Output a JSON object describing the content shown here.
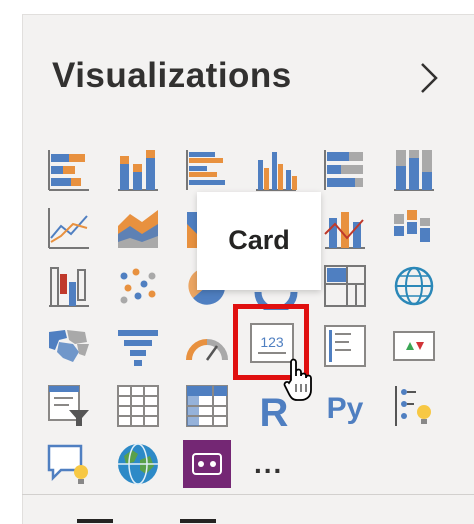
{
  "panel": {
    "title": "Visualizations"
  },
  "tooltip": {
    "text": "Card"
  },
  "more": {
    "label": "..."
  },
  "icons": {
    "collapse": "chevron-right-icon",
    "stacked_bar": "stacked-bar-chart-icon",
    "stacked_column": "stacked-column-chart-icon",
    "clustered_bar": "clustered-bar-chart-icon",
    "clustered_column": "clustered-column-chart-icon",
    "bar_100": "100-stacked-bar-chart-icon",
    "column_100": "100-stacked-column-chart-icon",
    "line": "line-chart-icon",
    "area": "area-chart-icon",
    "line_column": "line-and-column-chart-icon",
    "ribbon": "ribbon-chart-icon",
    "waterfall": "waterfall-chart-icon",
    "scatter": "scatter-chart-icon",
    "pie": "pie-chart-icon",
    "treemap": "treemap-icon",
    "map": "globe-map-icon",
    "filled_map": "filled-map-icon",
    "funnel": "funnel-icon",
    "gauge": "gauge-icon",
    "card": "card-123-icon",
    "multirow_card": "multi-row-card-icon",
    "kpi": "kpi-icon",
    "slicer": "slicer-icon",
    "table": "table-icon",
    "matrix": "matrix-icon",
    "r_visual": "r-script-icon",
    "python_visual": "python-icon",
    "key_influencers": "key-influencers-icon",
    "qa": "qa-chat-icon",
    "arcgis": "arcgis-globe-icon",
    "powerapps": "powerapps-icon",
    "cursor": "hand-pointer-cursor-icon"
  },
  "colors": {
    "blue": "#4f7fc1",
    "orange": "#e8913f",
    "gray": "#a9a9a9",
    "highlight": "#e01010",
    "powerapps": "#742774"
  }
}
